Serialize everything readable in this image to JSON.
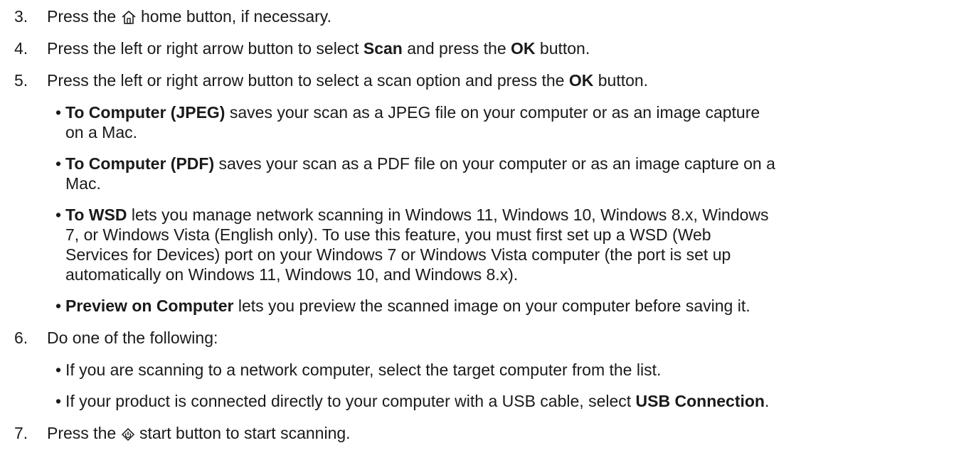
{
  "steps": [
    {
      "num": "3.",
      "pre": "Press the",
      "icon": "home-icon",
      "post": "home button, if necessary."
    },
    {
      "num": "4.",
      "pre": "Press the left or right arrow button to select ",
      "b1": "Scan",
      "mid": " and press the ",
      "b2": "OK",
      "post": " button."
    },
    {
      "num": "5.",
      "pre": "Press the left or right arrow button to select a scan option and press the ",
      "b1": "OK",
      "post": " button."
    },
    {
      "num": "6.",
      "text": "Do one of the following:"
    },
    {
      "num": "7.",
      "pre": "Press the",
      "icon": "start-icon",
      "post": "start button to start scanning."
    }
  ],
  "scan_options": [
    {
      "bold": "To Computer (JPEG)",
      "lines": [
        " saves your scan as a JPEG file on your computer or as an image capture",
        "on a Mac."
      ]
    },
    {
      "bold": "To Computer (PDF)",
      "lines": [
        " saves your scan as a PDF file on your computer or as an image capture on a",
        "Mac."
      ]
    },
    {
      "bold": "To WSD",
      "lines": [
        " lets you manage network scanning in Windows 11, Windows 10, Windows 8.x, Windows",
        "7, or Windows Vista (English only). To use this feature, you must first set up a WSD (Web",
        "Services for Devices) port on your Windows 7 or Windows Vista computer (the port is set up",
        "automatically on Windows 11, Windows 10, and Windows 8.x)."
      ]
    },
    {
      "bold": "Preview on Computer",
      "lines": [
        " lets you preview the scanned image on your computer before saving it."
      ]
    }
  ],
  "following": [
    {
      "text": "If you are scanning to a network computer, select the target computer from the list."
    },
    {
      "pre": "If your product is connected directly to your computer with a USB cable, select ",
      "bold": "USB Connection",
      "post": "."
    }
  ],
  "bullet_char": "•"
}
